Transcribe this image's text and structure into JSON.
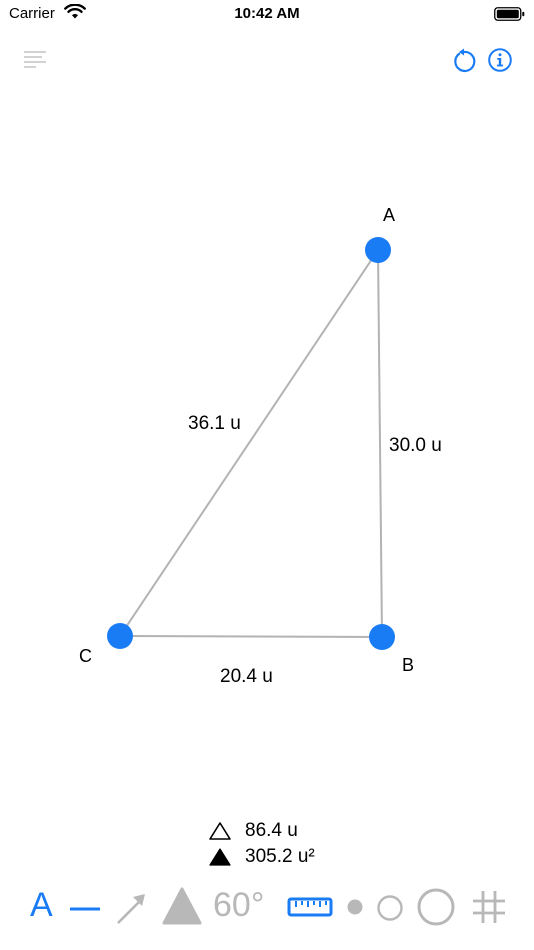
{
  "status_bar": {
    "carrier": "Carrier",
    "time": "10:42 AM"
  },
  "toolbar": {
    "menu_icon": "menu-lines-icon",
    "reset_icon": "reset-icon",
    "info_icon": "info-icon"
  },
  "triangle": {
    "vertices": {
      "A": "A",
      "B": "B",
      "C": "C"
    },
    "sides": {
      "AC": "36.1 u",
      "AB": "30.0 u",
      "CB": "20.4 u"
    }
  },
  "summary": {
    "perimeter": "86.4 u",
    "area": "305.2 u²"
  },
  "tools": {
    "label_tool": "A",
    "angle_tool": "60°"
  },
  "colors": {
    "accent": "#1a7cf5",
    "inactive": "#b8b8b8",
    "edge": "#b3b3b3"
  }
}
